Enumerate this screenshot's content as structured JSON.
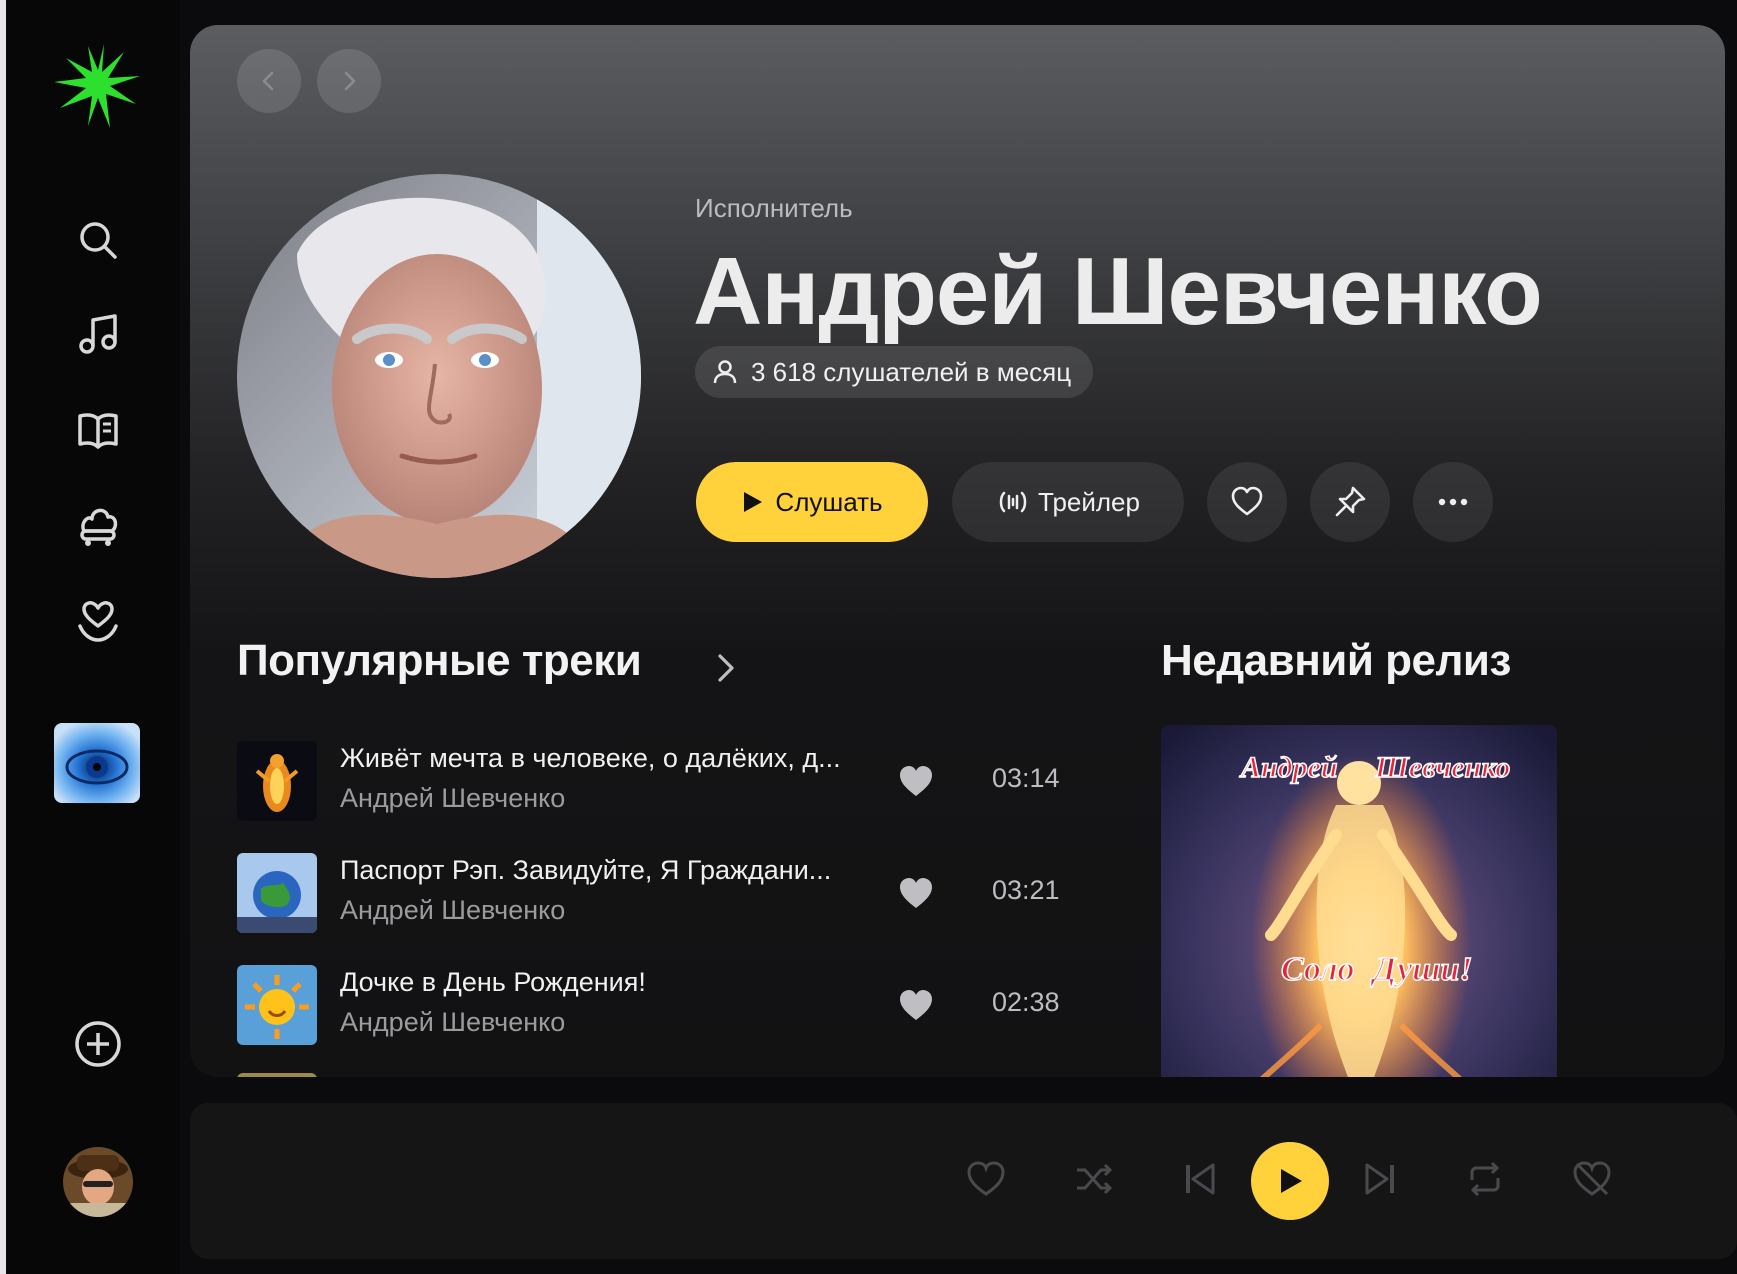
{
  "sidebar": {
    "nav": [
      "search-icon",
      "music-note-icon",
      "book-icon",
      "kids-icon",
      "heart-collection-icon"
    ],
    "add_icon": "add-circle-icon"
  },
  "artist": {
    "type_label": "Исполнитель",
    "name": "Андрей Шевченко",
    "listeners": "3 618 слушателей в месяц"
  },
  "actions": {
    "listen": "Слушать",
    "trailer": "Трейлер"
  },
  "popular": {
    "title": "Популярные треки",
    "tracks": [
      {
        "title": "Живёт мечта в человеке, о далёких, д...",
        "artist": "Андрей Шевченко",
        "duration": "03:14"
      },
      {
        "title": "Паспорт Рэп. Завидуйте, Я Граждани...",
        "artist": "Андрей Шевченко",
        "duration": "03:21"
      },
      {
        "title": "Дочке в День Рождения!",
        "artist": "Андрей Шевченко",
        "duration": "02:38"
      }
    ]
  },
  "recent": {
    "title": "Недавний релиз",
    "cover_text_top_left": "Андрей",
    "cover_text_top_right": "Шевченко",
    "cover_text_bottom_left": "Соло",
    "cover_text_bottom_right": "Души!"
  },
  "colors": {
    "accent": "#ffd13a",
    "logo": "#2ee02e",
    "background": "#0b0b0d"
  }
}
